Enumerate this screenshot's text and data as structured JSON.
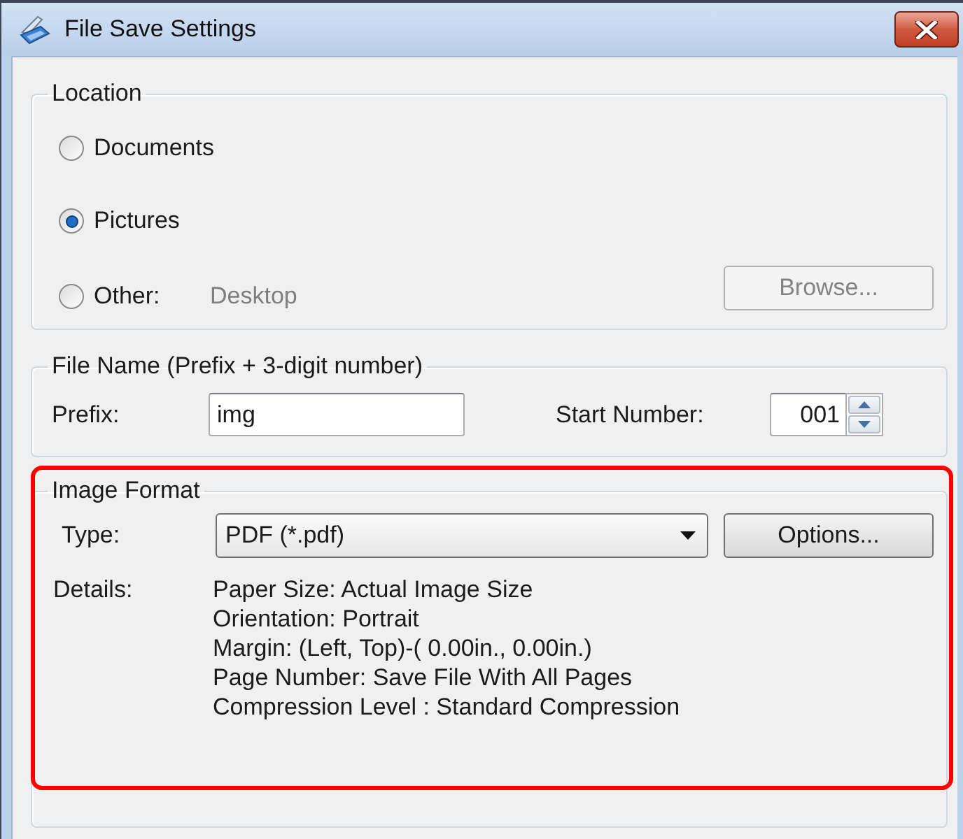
{
  "window": {
    "title": "File Save Settings"
  },
  "location": {
    "label": "Location",
    "options": [
      {
        "label": "Documents",
        "selected": false
      },
      {
        "label": "Pictures",
        "selected": true
      },
      {
        "label": "Other:",
        "selected": false,
        "path": "Desktop",
        "path_disabled": true
      }
    ],
    "browse_button": {
      "label": "Browse...",
      "disabled": true
    }
  },
  "file_name": {
    "label": "File Name (Prefix + 3-digit number)",
    "prefix": {
      "label": "Prefix:",
      "value": "img"
    },
    "start_number": {
      "label": "Start Number:",
      "value": "001"
    }
  },
  "image_format": {
    "label": "Image Format",
    "highlighted": true,
    "type": {
      "label": "Type:",
      "value": "PDF (*.pdf)"
    },
    "options_button": {
      "label": "Options..."
    },
    "details": {
      "label": "Details:",
      "lines": [
        "Paper Size: Actual Image Size",
        "Orientation: Portrait",
        "Margin: (Left, Top)-( 0.00in., 0.00in.)",
        "Page Number: Save File With All Pages",
        "Compression Level : Standard Compression"
      ]
    }
  }
}
